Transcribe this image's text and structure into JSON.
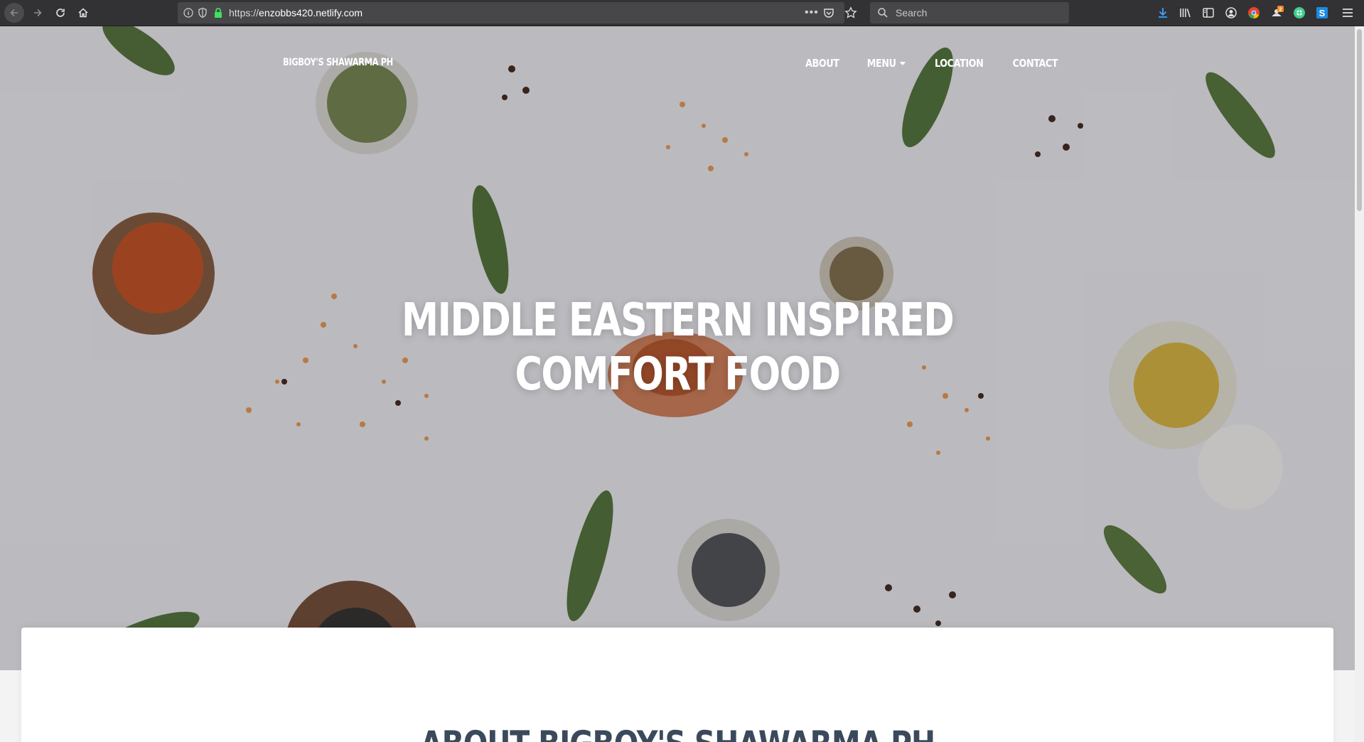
{
  "browser": {
    "url_scheme": "https://",
    "url_host": "enzobbs420.netlify.com",
    "more_glyph": "•••",
    "search_placeholder": "Search"
  },
  "site": {
    "brand": "BIGBOY'S SHAWARMA PH",
    "nav": [
      {
        "label": "ABOUT"
      },
      {
        "label": "MENU",
        "has_dropdown": true
      },
      {
        "label": "LOCATION"
      },
      {
        "label": "CONTACT"
      }
    ],
    "hero": {
      "title_line1": "MIDDLE EASTERN INSPIRED",
      "title_line2": "COMFORT FOOD"
    },
    "about": {
      "title": "ABOUT BIGBOY'S SHAWARMA PH"
    }
  },
  "colors": {
    "chrome": "#323234",
    "url_field": "#474749",
    "about_heading": "#3a4a5c",
    "white": "#ffffff"
  },
  "icons": [
    "back-icon",
    "forward-icon",
    "reload-icon",
    "home-icon",
    "info-icon",
    "shield-icon",
    "lock-icon",
    "pocket-icon",
    "star-icon",
    "search-icon",
    "download-icon",
    "library-icon",
    "sidebar-icon",
    "account-icon",
    "chrome-extension-icon",
    "notification-extension-icon",
    "vpn-extension-icon",
    "s-extension-icon",
    "hamburger-menu-icon"
  ],
  "notification_badge": "2",
  "s_extension_letter": "S"
}
